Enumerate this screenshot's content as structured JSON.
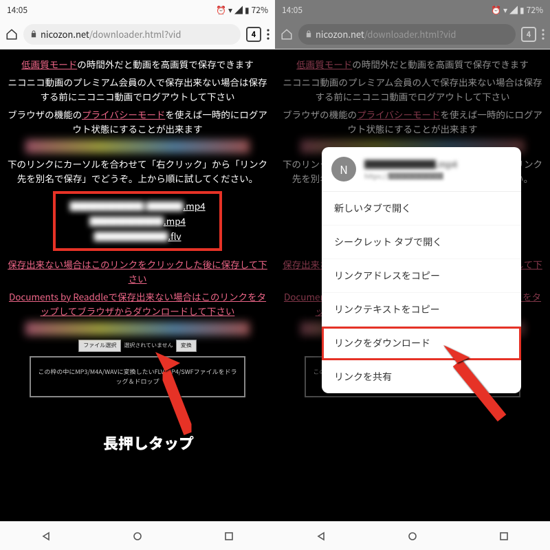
{
  "status": {
    "time": "14:05",
    "battery": "72%",
    "icons": [
      "alarm",
      "wifi",
      "signal",
      "battery"
    ]
  },
  "browser": {
    "url_display": {
      "domain": "nicozon.net",
      "path": "/downloader.html?vid"
    },
    "tab_count": "4"
  },
  "page": {
    "low_quality_link": "低画質モード",
    "para1_tail": "の時間外だと動画を高画質で保存できます",
    "para2": "ニコニコ動画のプレミアム会員の人で保存出来ない場合は保存する前にニコニコ動画でログアウトして下さい",
    "para3_pre": "ブラウザの機能の",
    "privacy_link": "プライバシーモード",
    "para3_post": "を使えば一時的にログアウト状態にすることが出来ます",
    "para4": "下のリンクにカーソルを合わせて「右クリック」から「リンク先を別名で保存」でどうぞ。上から順に試してください。",
    "files": [
      {
        "blurred": "████████ ████",
        "ext": ".mp4"
      },
      {
        "blurred": "████████",
        "ext": ".mp4"
      },
      {
        "blurred": "████████",
        "ext": ".flv"
      }
    ],
    "save_fail_link": "保存出来ない場合はこのリンクをクリックした後に保存して下さい",
    "documents_pre": "Documents by Readdle",
    "documents_link": "で保存出来ない場合はこのリンクをタップしてブラウザからダウンロードして下さい",
    "file_select": "ファイル選択",
    "file_none": "選択されていません",
    "convert": "変換",
    "dropzone": "この枠の中にMP3/M4A/WAVに変換したいFLV/MP4/SWFファイルをドラッグ＆ドロップ"
  },
  "annotation": {
    "longpress": "長押しタップ"
  },
  "context_menu": {
    "file_title": "████████.mp4",
    "file_url": "https://████████",
    "avatar_letter": "N",
    "items": [
      "新しいタブで開く",
      "シークレット タブで開く",
      "リンクアドレスをコピー",
      "リンクテキストをコピー",
      "リンクをダウンロード",
      "リンクを共有"
    ],
    "highlight_index": 4
  }
}
